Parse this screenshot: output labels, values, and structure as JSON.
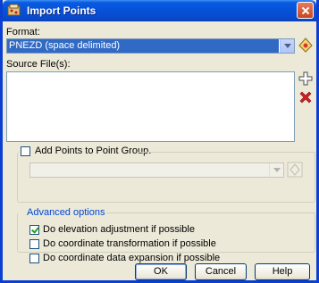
{
  "window": {
    "title": "Import Points"
  },
  "format": {
    "label": "Format:",
    "selected_value": "PNEZD (space delimited)"
  },
  "source_files": {
    "label": "Source File(s):",
    "files": []
  },
  "point_group": {
    "checkbox_label": "Add Points to Point Group.",
    "checked": false,
    "selected_value": ""
  },
  "advanced": {
    "legend": "Advanced options",
    "options": [
      {
        "label": "Do elevation adjustment if possible",
        "checked": true
      },
      {
        "label": "Do coordinate transformation if possible",
        "checked": false
      },
      {
        "label": "Do coordinate data expansion if possible",
        "checked": false
      }
    ]
  },
  "buttons": {
    "ok": "OK",
    "cancel": "Cancel",
    "help": "Help"
  },
  "icons": {
    "title": "import-points-icon",
    "format_manager": "point-file-format-icon",
    "add_file": "add-file-icon",
    "remove_file": "remove-file-icon",
    "point_group_properties": "point-group-icon"
  },
  "colors": {
    "title_bar": "#0552d8",
    "dialog_bg": "#ece9d8",
    "selection": "#316ac5",
    "remove_red": "#d42020",
    "legend_blue": "#0046d5"
  }
}
